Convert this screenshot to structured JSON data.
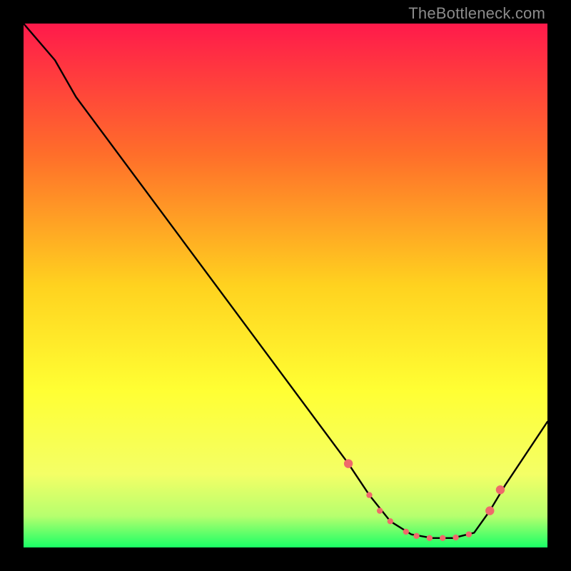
{
  "watermark": "TheBottleneck.com",
  "chart_data": {
    "type": "line",
    "title": "",
    "xlabel": "",
    "ylabel": "",
    "xlim": [
      0,
      100
    ],
    "ylim": [
      0,
      100
    ],
    "gradient_stops": [
      {
        "offset": 0,
        "color": "#ff1a4b"
      },
      {
        "offset": 0.25,
        "color": "#ff6e2a"
      },
      {
        "offset": 0.5,
        "color": "#ffd21f"
      },
      {
        "offset": 0.7,
        "color": "#ffff33"
      },
      {
        "offset": 0.86,
        "color": "#f4ff66"
      },
      {
        "offset": 0.94,
        "color": "#b6ff6e"
      },
      {
        "offset": 1.0,
        "color": "#1aff66"
      }
    ],
    "series": [
      {
        "name": "curve",
        "color": "#000000",
        "points": [
          {
            "x": 0,
            "y": 100
          },
          {
            "x": 6,
            "y": 93
          },
          {
            "x": 10,
            "y": 86
          },
          {
            "x": 62,
            "y": 16
          },
          {
            "x": 66,
            "y": 10
          },
          {
            "x": 70,
            "y": 5
          },
          {
            "x": 74,
            "y": 2.5
          },
          {
            "x": 78,
            "y": 1.8
          },
          {
            "x": 82,
            "y": 1.8
          },
          {
            "x": 86,
            "y": 2.8
          },
          {
            "x": 89,
            "y": 7
          },
          {
            "x": 92,
            "y": 12
          },
          {
            "x": 100,
            "y": 24
          }
        ]
      }
    ],
    "markers": {
      "color": "#ef6a6a",
      "radius_small": 4.2,
      "radius_large": 6.2,
      "points": [
        {
          "x": 62,
          "y": 16,
          "r": "large"
        },
        {
          "x": 66,
          "y": 10,
          "r": "small"
        },
        {
          "x": 68,
          "y": 7,
          "r": "small"
        },
        {
          "x": 70,
          "y": 5,
          "r": "small"
        },
        {
          "x": 73,
          "y": 3,
          "r": "small"
        },
        {
          "x": 75,
          "y": 2.2,
          "r": "small"
        },
        {
          "x": 77.5,
          "y": 1.8,
          "r": "small"
        },
        {
          "x": 80,
          "y": 1.8,
          "r": "small"
        },
        {
          "x": 82.5,
          "y": 1.9,
          "r": "small"
        },
        {
          "x": 85,
          "y": 2.5,
          "r": "small"
        },
        {
          "x": 89,
          "y": 7,
          "r": "large"
        },
        {
          "x": 91,
          "y": 11,
          "r": "large"
        }
      ]
    }
  }
}
